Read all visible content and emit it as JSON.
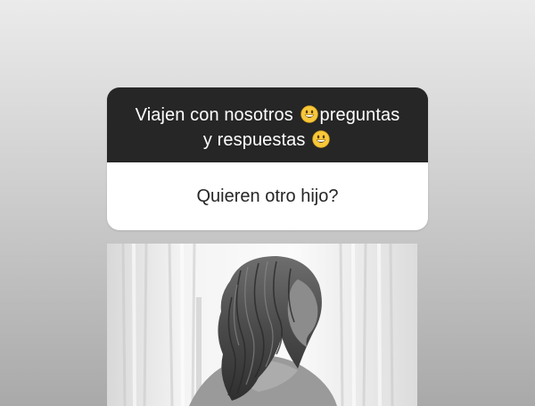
{
  "question_card": {
    "question_part1": "Viajen con nosotros ",
    "question_part2": "preguntas",
    "question_line2": "y respuestas ",
    "emoji_name": "grinning-face-icon",
    "answer": "Quieren otro hijo?",
    "header_color": "#262626",
    "answer_bg_color": "#ffffff"
  },
  "photo": {
    "style": "black-and-white",
    "subject": "woman-with-long-wavy-hair-icon"
  }
}
